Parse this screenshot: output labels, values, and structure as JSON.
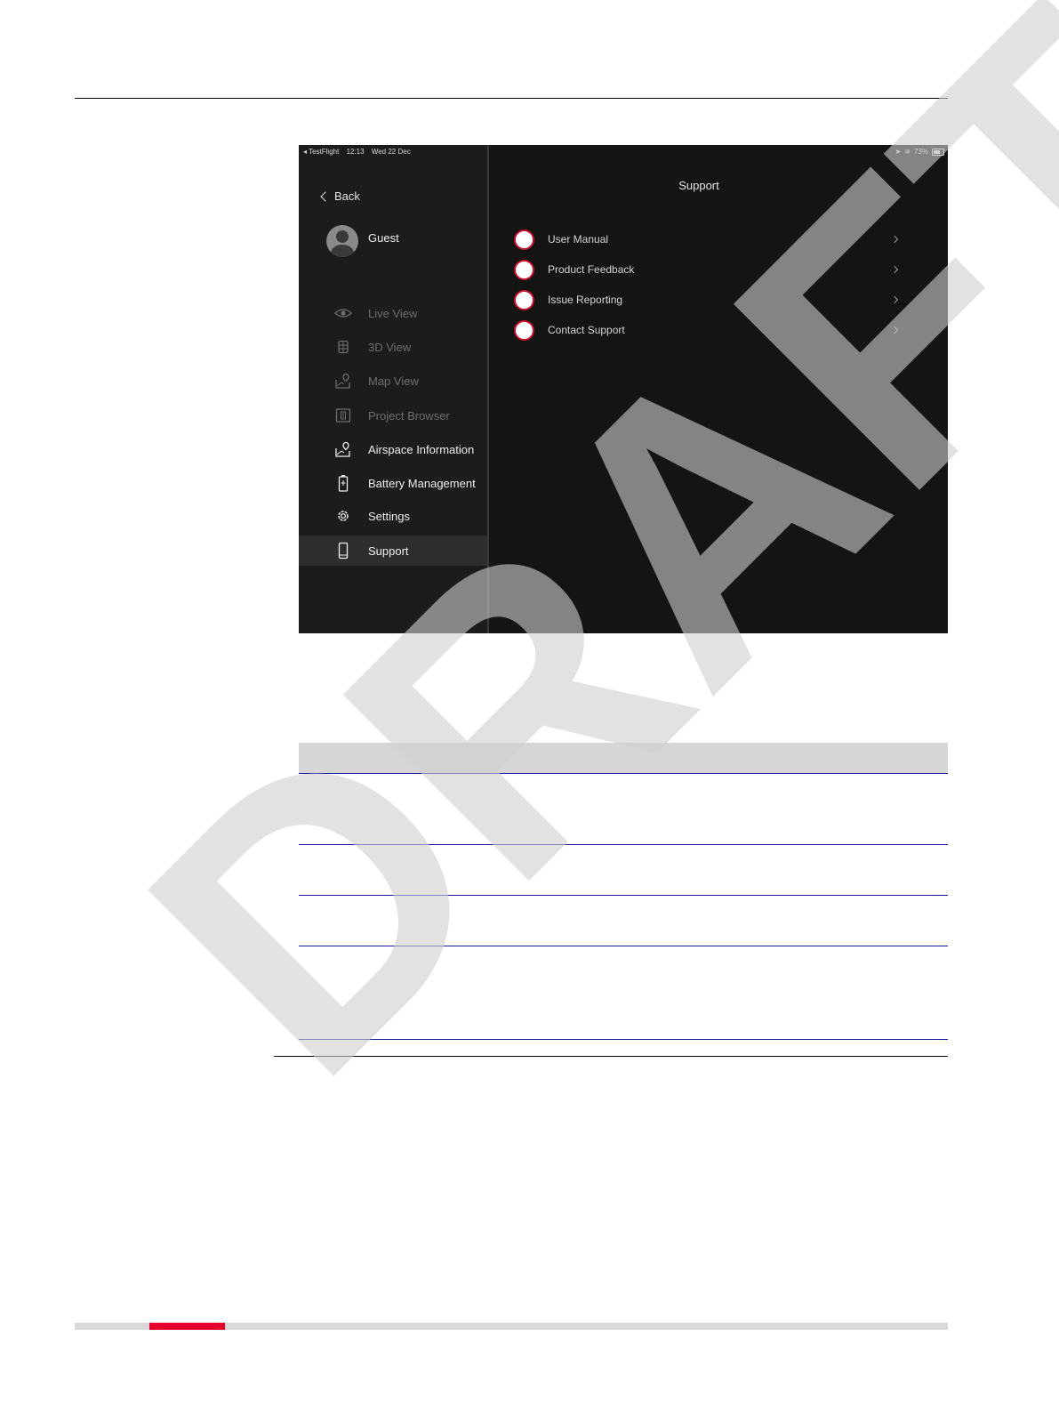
{
  "status_bar": {
    "app": "◂ TestFlight",
    "time": "12:13",
    "date": "Wed 22 Dec",
    "battery": "73%"
  },
  "sidebar": {
    "back_label": "Back",
    "user_name": "Guest",
    "items": [
      {
        "label": "Live View",
        "icon": "eye-icon",
        "enabled": false
      },
      {
        "label": "3D View",
        "icon": "cube-icon",
        "enabled": false
      },
      {
        "label": "Map View",
        "icon": "map-pin-icon",
        "enabled": false
      },
      {
        "label": "Project Browser",
        "icon": "folder-icon",
        "enabled": false
      },
      {
        "label": "Airspace Information",
        "icon": "map-pin-icon",
        "enabled": true
      },
      {
        "label": "Battery Management",
        "icon": "battery-icon",
        "enabled": true
      },
      {
        "label": "Settings",
        "icon": "gear-icon",
        "enabled": true
      },
      {
        "label": "Support",
        "icon": "phone-icon",
        "enabled": true,
        "selected": true
      }
    ]
  },
  "main": {
    "title": "Support",
    "rows": [
      {
        "label": "User Manual"
      },
      {
        "label": "Product Feedback"
      },
      {
        "label": "Issue Reporting"
      },
      {
        "label": "Contact Support"
      }
    ]
  },
  "watermark": "DRAFT",
  "colors": {
    "accent": "#e4002b",
    "badge_border": "#c8102e",
    "table_rule": "#1a1aa0",
    "screen_bg": "#141414"
  }
}
